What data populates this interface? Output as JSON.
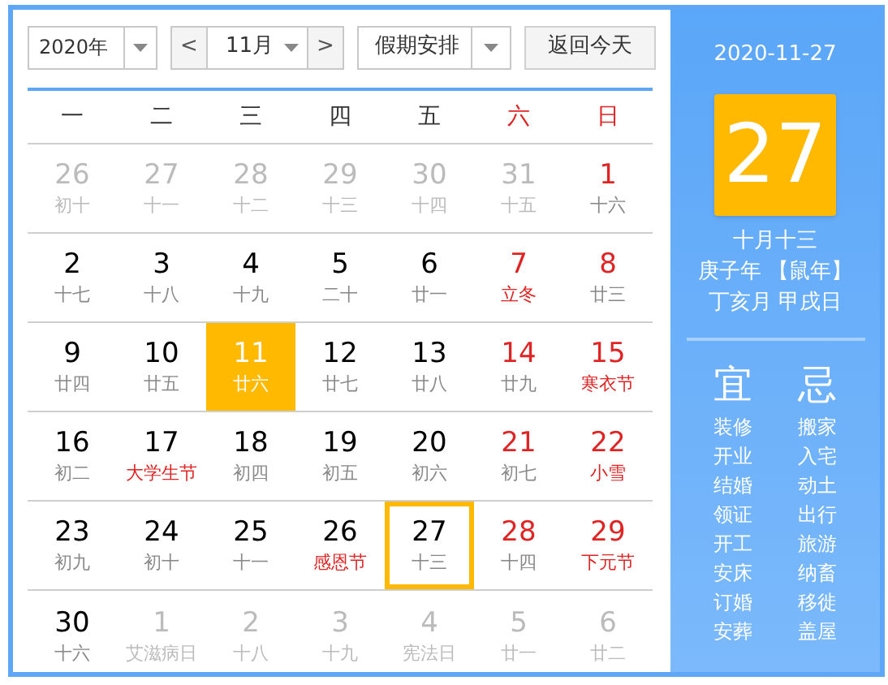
{
  "toolbar": {
    "year": "2020年",
    "month": "11月",
    "prev": "<",
    "next": ">",
    "holiday": "假期安排",
    "today_button": "返回今天"
  },
  "weekdays": [
    {
      "label": "一",
      "weekend": false
    },
    {
      "label": "二",
      "weekend": false
    },
    {
      "label": "三",
      "weekend": false
    },
    {
      "label": "四",
      "weekend": false
    },
    {
      "label": "五",
      "weekend": false
    },
    {
      "label": "六",
      "weekend": true
    },
    {
      "label": "日",
      "weekend": true
    }
  ],
  "weeks": [
    [
      {
        "day": "26",
        "lunar": "初十",
        "other_month": true,
        "weekend": false,
        "festival": false,
        "selected": false,
        "today": false
      },
      {
        "day": "27",
        "lunar": "十一",
        "other_month": true,
        "weekend": false,
        "festival": false,
        "selected": false,
        "today": false
      },
      {
        "day": "28",
        "lunar": "十二",
        "other_month": true,
        "weekend": false,
        "festival": false,
        "selected": false,
        "today": false
      },
      {
        "day": "29",
        "lunar": "十三",
        "other_month": true,
        "weekend": false,
        "festival": false,
        "selected": false,
        "today": false
      },
      {
        "day": "30",
        "lunar": "十四",
        "other_month": true,
        "weekend": false,
        "festival": false,
        "selected": false,
        "today": false
      },
      {
        "day": "31",
        "lunar": "十五",
        "other_month": true,
        "weekend": false,
        "festival": false,
        "selected": false,
        "today": false
      },
      {
        "day": "1",
        "lunar": "十六",
        "other_month": false,
        "weekend": true,
        "festival": false,
        "selected": false,
        "today": false
      }
    ],
    [
      {
        "day": "2",
        "lunar": "十七",
        "other_month": false,
        "weekend": false,
        "festival": false,
        "selected": false,
        "today": false
      },
      {
        "day": "3",
        "lunar": "十八",
        "other_month": false,
        "weekend": false,
        "festival": false,
        "selected": false,
        "today": false
      },
      {
        "day": "4",
        "lunar": "十九",
        "other_month": false,
        "weekend": false,
        "festival": false,
        "selected": false,
        "today": false
      },
      {
        "day": "5",
        "lunar": "二十",
        "other_month": false,
        "weekend": false,
        "festival": false,
        "selected": false,
        "today": false
      },
      {
        "day": "6",
        "lunar": "廿一",
        "other_month": false,
        "weekend": false,
        "festival": false,
        "selected": false,
        "today": false
      },
      {
        "day": "7",
        "lunar": "立冬",
        "other_month": false,
        "weekend": true,
        "festival": true,
        "selected": false,
        "today": false
      },
      {
        "day": "8",
        "lunar": "廿三",
        "other_month": false,
        "weekend": true,
        "festival": false,
        "selected": false,
        "today": false
      }
    ],
    [
      {
        "day": "9",
        "lunar": "廿四",
        "other_month": false,
        "weekend": false,
        "festival": false,
        "selected": false,
        "today": false
      },
      {
        "day": "10",
        "lunar": "廿五",
        "other_month": false,
        "weekend": false,
        "festival": false,
        "selected": false,
        "today": false
      },
      {
        "day": "11",
        "lunar": "廿六",
        "other_month": false,
        "weekend": false,
        "festival": false,
        "selected": true,
        "today": false
      },
      {
        "day": "12",
        "lunar": "廿七",
        "other_month": false,
        "weekend": false,
        "festival": false,
        "selected": false,
        "today": false
      },
      {
        "day": "13",
        "lunar": "廿八",
        "other_month": false,
        "weekend": false,
        "festival": false,
        "selected": false,
        "today": false
      },
      {
        "day": "14",
        "lunar": "廿九",
        "other_month": false,
        "weekend": true,
        "festival": false,
        "selected": false,
        "today": false
      },
      {
        "day": "15",
        "lunar": "寒衣节",
        "other_month": false,
        "weekend": true,
        "festival": true,
        "selected": false,
        "today": false
      }
    ],
    [
      {
        "day": "16",
        "lunar": "初二",
        "other_month": false,
        "weekend": false,
        "festival": false,
        "selected": false,
        "today": false
      },
      {
        "day": "17",
        "lunar": "大学生节",
        "other_month": false,
        "weekend": false,
        "festival": true,
        "selected": false,
        "today": false
      },
      {
        "day": "18",
        "lunar": "初四",
        "other_month": false,
        "weekend": false,
        "festival": false,
        "selected": false,
        "today": false
      },
      {
        "day": "19",
        "lunar": "初五",
        "other_month": false,
        "weekend": false,
        "festival": false,
        "selected": false,
        "today": false
      },
      {
        "day": "20",
        "lunar": "初六",
        "other_month": false,
        "weekend": false,
        "festival": false,
        "selected": false,
        "today": false
      },
      {
        "day": "21",
        "lunar": "初七",
        "other_month": false,
        "weekend": true,
        "festival": false,
        "selected": false,
        "today": false
      },
      {
        "day": "22",
        "lunar": "小雪",
        "other_month": false,
        "weekend": true,
        "festival": true,
        "selected": false,
        "today": false
      }
    ],
    [
      {
        "day": "23",
        "lunar": "初九",
        "other_month": false,
        "weekend": false,
        "festival": false,
        "selected": false,
        "today": false
      },
      {
        "day": "24",
        "lunar": "初十",
        "other_month": false,
        "weekend": false,
        "festival": false,
        "selected": false,
        "today": false
      },
      {
        "day": "25",
        "lunar": "十一",
        "other_month": false,
        "weekend": false,
        "festival": false,
        "selected": false,
        "today": false
      },
      {
        "day": "26",
        "lunar": "感恩节",
        "other_month": false,
        "weekend": false,
        "festival": true,
        "selected": false,
        "today": false
      },
      {
        "day": "27",
        "lunar": "十三",
        "other_month": false,
        "weekend": false,
        "festival": false,
        "selected": false,
        "today": true
      },
      {
        "day": "28",
        "lunar": "十四",
        "other_month": false,
        "weekend": true,
        "festival": false,
        "selected": false,
        "today": false
      },
      {
        "day": "29",
        "lunar": "下元节",
        "other_month": false,
        "weekend": true,
        "festival": true,
        "selected": false,
        "today": false
      }
    ],
    [
      {
        "day": "30",
        "lunar": "十六",
        "other_month": false,
        "weekend": false,
        "festival": false,
        "selected": false,
        "today": false
      },
      {
        "day": "1",
        "lunar": "艾滋病日",
        "other_month": true,
        "weekend": false,
        "festival": false,
        "selected": false,
        "today": false
      },
      {
        "day": "2",
        "lunar": "十八",
        "other_month": true,
        "weekend": false,
        "festival": false,
        "selected": false,
        "today": false
      },
      {
        "day": "3",
        "lunar": "十九",
        "other_month": true,
        "weekend": false,
        "festival": false,
        "selected": false,
        "today": false
      },
      {
        "day": "4",
        "lunar": "宪法日",
        "other_month": true,
        "weekend": false,
        "festival": false,
        "selected": false,
        "today": false
      },
      {
        "day": "5",
        "lunar": "廿一",
        "other_month": true,
        "weekend": false,
        "festival": false,
        "selected": false,
        "today": false
      },
      {
        "day": "6",
        "lunar": "廿二",
        "other_month": true,
        "weekend": false,
        "festival": false,
        "selected": false,
        "today": false
      }
    ]
  ],
  "detail": {
    "date": "2020-11-27",
    "day": "27",
    "lunar_date": "十月十三",
    "year_text": "庚子年 【鼠年】",
    "month_day_text": "丁亥月 甲戌日",
    "good": {
      "title": "宜",
      "items": [
        "装修",
        "开业",
        "结婚",
        "领证",
        "开工",
        "安床",
        "订婚",
        "安葬"
      ]
    },
    "bad": {
      "title": "忌",
      "items": [
        "搬家",
        "入宅",
        "动土",
        "出行",
        "旅游",
        "纳畜",
        "移徙",
        "盖屋"
      ]
    }
  }
}
